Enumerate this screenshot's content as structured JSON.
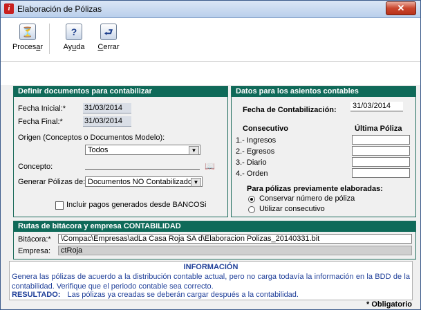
{
  "window": {
    "title": "Elaboración de Pólizas",
    "close": "✕"
  },
  "toolbar": [
    {
      "icon": "⏳",
      "label_pre": "Proces",
      "label_u": "a",
      "label_post": "r"
    },
    {
      "icon": "?",
      "label_pre": "Ay",
      "label_u": "u",
      "label_post": "da"
    },
    {
      "icon": "⮐",
      "label_pre": "",
      "label_u": "C",
      "label_post": "errar"
    }
  ],
  "left_panel": {
    "header": "Definir documentos para contabilizar",
    "fecha_inicial_label": "Fecha Inicial:*",
    "fecha_inicial": "31/03/2014",
    "fecha_final_label": "Fecha Final:*",
    "fecha_final": "31/03/2014",
    "origen_label": "Origen (Conceptos o Documentos Modelo):",
    "origen_value": "Todos",
    "concepto_label": "Concepto:",
    "generar_label": "Generar Pólizas de:",
    "generar_value": "Documentos NO Contabilizado",
    "incluir_label": "Incluir pagos generados desde BANCOSi"
  },
  "right_panel": {
    "header": "Datos para los asientos contables",
    "fecha_contab_label": "Fecha de Contabilización:",
    "fecha_contab": "31/03/2014",
    "consecutivo_label": "Consecutivo",
    "ultima_label": "Última Póliza",
    "rows": [
      "1.- Ingresos",
      "2.- Egresos",
      "3.- Diario",
      "4.- Orden"
    ],
    "previas_label": "Para pólizas previamente elaboradas:",
    "conservar_label": "Conservar número de póliza",
    "utilizar_label": "Utilizar consecutivo"
  },
  "rutas": {
    "header": "Rutas de bitácora y empresa CONTABILIDAD",
    "bitacora_label": "Bitácora:*",
    "bitacora_value": "\\Compac\\Empresas\\adLa Casa Roja SA d\\Elaboracion Polizas_20140331.bit",
    "empresa_label": "Empresa:",
    "empresa_value": "ctRoja"
  },
  "info": {
    "title": "INFORMACIÓN",
    "text": "Genera las pólizas de acuerdo a la distribución contable actual, pero no carga todavía la información en la BDD de la contabilidad. Verifique que el periodo contable sea correcto.",
    "result_label": "RESULTADO:",
    "result_text": "Las pólizas ya creadas se deberán cargar después a la contabilidad."
  },
  "footer": {
    "mandatory": "* Obligatorio"
  }
}
